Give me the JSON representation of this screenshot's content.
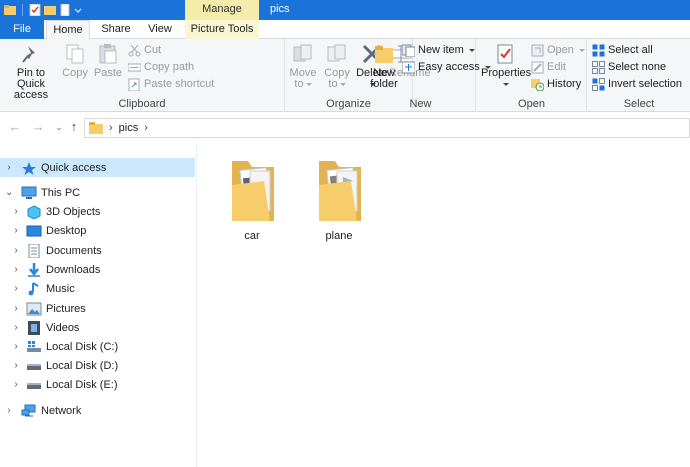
{
  "window": {
    "title": "pics",
    "manage_tab": "Manage"
  },
  "ribbon_tabs": [
    {
      "label": "File"
    },
    {
      "label": "Home"
    },
    {
      "label": "Share"
    },
    {
      "label": "View"
    },
    {
      "label": "Picture Tools"
    }
  ],
  "clipboard": {
    "pin_label_1": "Pin to Quick",
    "pin_label_2": "access",
    "copy": "Copy",
    "paste": "Paste",
    "cut": "Cut",
    "copy_path": "Copy path",
    "paste_shortcut": "Paste shortcut",
    "group": "Clipboard"
  },
  "organize": {
    "move_to": "Move",
    "move_to_2": "to",
    "copy_to": "Copy",
    "copy_to_2": "to",
    "delete": "Delete",
    "rename": "Rename",
    "group": "Organize"
  },
  "new_group": {
    "new_folder_1": "New",
    "new_folder_2": "folder",
    "new_item": "New item",
    "easy_access": "Easy access",
    "group": "New"
  },
  "open_group": {
    "properties": "Properties",
    "open": "Open",
    "edit": "Edit",
    "history": "History",
    "group": "Open"
  },
  "select_group": {
    "select_all": "Select all",
    "select_none": "Select none",
    "invert_selection": "Invert selection",
    "group": "Select"
  },
  "address": {
    "crumb": "pics"
  },
  "nav": {
    "quick_access": "Quick access",
    "this_pc": "This PC",
    "items": [
      {
        "label": "3D Objects"
      },
      {
        "label": "Desktop"
      },
      {
        "label": "Documents"
      },
      {
        "label": "Downloads"
      },
      {
        "label": "Music"
      },
      {
        "label": "Pictures"
      },
      {
        "label": "Videos"
      },
      {
        "label": "Local Disk (C:)"
      },
      {
        "label": "Local Disk (D:)"
      },
      {
        "label": "Local Disk (E:)"
      }
    ],
    "network": "Network"
  },
  "folders": [
    {
      "name": "car"
    },
    {
      "name": "plane"
    }
  ],
  "colors": {
    "accent": "#1a73d9",
    "manage": "#f5ecac",
    "selection": "#cce8ff",
    "folder": "#f6cd6a"
  }
}
